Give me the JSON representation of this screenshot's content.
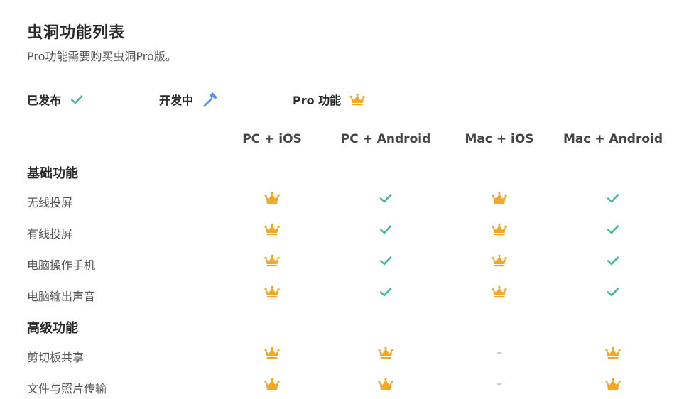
{
  "page": {
    "title": "虫洞功能列表",
    "subtitle": "Pro功能需要购买虫洞Pro版。"
  },
  "legend": [
    {
      "label": "已发布",
      "icon": "check-icon"
    },
    {
      "label": "开发中",
      "icon": "hammer-icon"
    },
    {
      "label": "Pro 功能",
      "icon": "crown-icon"
    }
  ],
  "columns": [
    "PC + iOS",
    "PC + Android",
    "Mac + iOS",
    "Mac + Android"
  ],
  "sections": [
    {
      "title": "基础功能",
      "rows": [
        {
          "label": "无线投屏",
          "cells": [
            "pro",
            "released",
            "pro",
            "released"
          ]
        },
        {
          "label": "有线投屏",
          "cells": [
            "pro",
            "released",
            "pro",
            "released"
          ]
        },
        {
          "label": "电脑操作手机",
          "cells": [
            "pro",
            "released",
            "pro",
            "released"
          ]
        },
        {
          "label": "电脑输出声音",
          "cells": [
            "pro",
            "released",
            "pro",
            "released"
          ]
        }
      ]
    },
    {
      "title": "高级功能",
      "rows": [
        {
          "label": "剪切板共享",
          "cells": [
            "pro",
            "pro",
            "none",
            "pro"
          ]
        },
        {
          "label": "文件与照片传输",
          "cells": [
            "pro",
            "pro",
            "none",
            "pro"
          ]
        }
      ]
    }
  ],
  "symbols": {
    "none": "–"
  },
  "colors": {
    "check": "#3dba8c",
    "crown": "#f5a623",
    "hammer": "#5b8def"
  }
}
